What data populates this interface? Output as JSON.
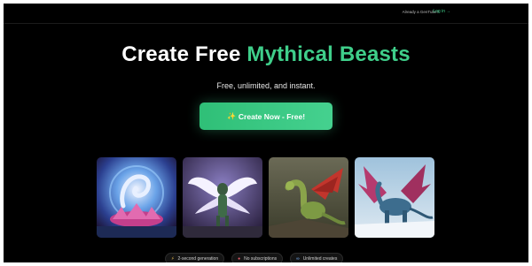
{
  "topbar": {
    "already_text": "Already a GenTube?",
    "login_label": "Log in",
    "login_arrow": "→"
  },
  "hero": {
    "title_part1": "Create Free",
    "title_accent": "Mythical Beasts",
    "subtitle": "Free, unlimited, and instant.",
    "cta_icon": "✨",
    "cta_label": "Create Now - Free!",
    "accent_color": "#3fce8a"
  },
  "gallery": [
    {
      "subject": "dragon-nebula-lotus"
    },
    {
      "subject": "winged-lion"
    },
    {
      "subject": "green-red-dragon"
    },
    {
      "subject": "blue-dragon-snow"
    }
  ],
  "features": [
    {
      "icon": "⚡",
      "label": "2-second generation"
    },
    {
      "icon": "●",
      "label": "No subscriptions"
    },
    {
      "icon": "∞",
      "label": "Unlimited creates"
    }
  ]
}
